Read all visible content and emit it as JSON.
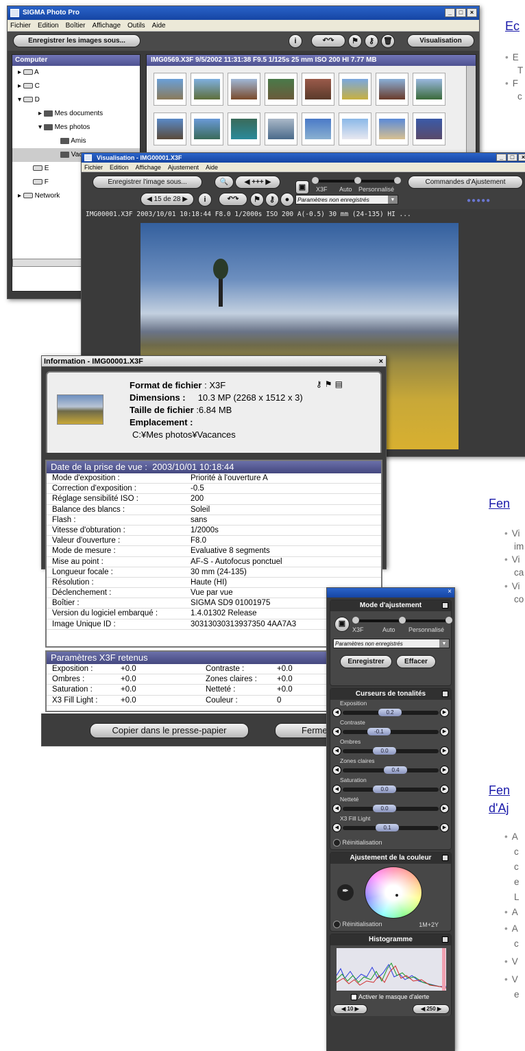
{
  "main_window": {
    "title": "SIGMA Photo Pro",
    "menu": [
      "Fichier",
      "Edition",
      "Boîtier",
      "Affichage",
      "Outils",
      "Aide"
    ],
    "save_images_label": "Enregistrer les images sous...",
    "view_label": "Visualisation",
    "panel_header": "Computer",
    "info_bar": "IMG0569.X3F 9/5/2002 11:31:38 F9.5 1/125s 25 mm ISO 200 HI 7.77 MB",
    "tree": [
      "A",
      "C",
      "D",
      "Mes documents",
      "Mes photos",
      "Amis",
      "Vacances",
      "E",
      "F",
      "Network"
    ]
  },
  "view_window": {
    "title": "Visualisation - IMG00001.X3F",
    "menu": [
      "Fichier",
      "Edition",
      "Affichage",
      "Ajustement",
      "Aide"
    ],
    "save_image_label": "Enregistrer l'image sous...",
    "zoom_label": "+++",
    "mode_x3f": "X3F",
    "mode_auto": "Auto",
    "mode_custom": "Personnalisé",
    "adjust_cmd_label": "Commandes d'Ajustement",
    "counter": "15 de 28",
    "params_unsaved": "Paramètres non enregistrés",
    "status": "IMG00001.X3F   2003/10/01   10:18:44   F8.0   1/2000s   ISO 200   A(-0.5)   30 mm (24-135)   HI   ..."
  },
  "info_window": {
    "title": "Information - IMG00001.X3F",
    "format_label": "Format de fichier",
    "format_value": "X3F",
    "dimensions_label": "Dimensions :",
    "dimensions_value": "10.3 MP (2268 x 1512 x 3)",
    "size_label": "Taille de fichier",
    "size_value": ":6.84 MB",
    "location_label": "Emplacement :",
    "location_value": "C:¥Mes photos¥Vacances",
    "date_label": "Date de la prise de vue :",
    "date_value": "2003/10/01    10:18:44",
    "rows": [
      {
        "k": "Mode d'exposition :",
        "v": "Priorité à l'ouverture A"
      },
      {
        "k": "Correction d'exposition :",
        "v": "-0.5"
      },
      {
        "k": "Réglage sensibilité ISO :",
        "v": "200"
      },
      {
        "k": "Balance des blancs :",
        "v": "Soleil"
      },
      {
        "k": "Flash :",
        "v": "sans"
      },
      {
        "k": "Vitesse d'obturation :",
        "v": "1/2000s"
      },
      {
        "k": "Valeur d'ouverture :",
        "v": "F8.0"
      },
      {
        "k": "Mode de mesure :",
        "v": "Evaluative 8 segments"
      },
      {
        "k": "Mise au point :",
        "v": "AF-S - Autofocus ponctuel"
      },
      {
        "k": "Longueur focale :",
        "v": "30 mm (24-135)"
      },
      {
        "k": "Résolution :",
        "v": "Haute (HI)"
      },
      {
        "k": "Déclenchement :",
        "v": "Vue par vue"
      },
      {
        "k": "Boîtier :",
        "v": "SIGMA SD9 01001975"
      },
      {
        "k": "Version du logiciel embarqué :",
        "v": "1.4.01302 Release"
      },
      {
        "k": "Image Unique ID :",
        "v": "30313030313937350 4AA7A3"
      }
    ],
    "x3f_header": "Paramètres X3F retenus",
    "x3f_rows": [
      {
        "a": "Exposition :",
        "av": "+0.0",
        "b": "Contraste :",
        "bv": "+0.0"
      },
      {
        "a": "Ombres :",
        "av": "+0.0",
        "b": "Zones claires :",
        "bv": "+0.0"
      },
      {
        "a": "Saturation :",
        "av": "+0.0",
        "b": "Netteté :",
        "bv": "+0.0"
      },
      {
        "a": "X3 Fill Light :",
        "av": "+0.0",
        "b": "Couleur :",
        "bv": "0"
      }
    ],
    "copy_label": "Copier dans le presse-papier",
    "close_label": "Fermer"
  },
  "palette": {
    "mode_header": "Mode d'ajustement",
    "mode_x3f": "X3F",
    "mode_auto": "Auto",
    "mode_custom": "Personnalisé",
    "params": "Paramètres non enregistrés",
    "save_label": "Enregistrer",
    "clear_label": "Effacer",
    "tone_header": "Curseurs de tonalités",
    "sliders": [
      {
        "label": "Exposition",
        "value": "0.2"
      },
      {
        "label": "Contraste",
        "value": "-0.1"
      },
      {
        "label": "Ombres",
        "value": "0.0"
      },
      {
        "label": "Zones claires",
        "value": "0.4"
      },
      {
        "label": "Saturation",
        "value": "0.0"
      },
      {
        "label": "Netteté",
        "value": "0.0"
      },
      {
        "label": "X3 Fill Light",
        "value": "0.1"
      }
    ],
    "reset_label": "Réinitialisation",
    "color_header": "Ajustement de la couleur",
    "color_reset_label": "Réinitialisation",
    "color_value": "1M+2Y",
    "histo_header": "Histogramme",
    "alert_label": "Activer le masque d'alerte",
    "low_value": "10",
    "high_value": "250"
  },
  "page_text": {
    "link1": "Ec",
    "bullets1": [
      "E",
      "T",
      "F",
      "c"
    ],
    "link2": "Fen",
    "bullets2": [
      "Vi",
      "im",
      "Vi",
      "ca",
      "Vi",
      "co"
    ],
    "link3a": "Fen",
    "link3b": "d'Aj",
    "bullets3": [
      "A",
      "c",
      "c",
      "e",
      "L",
      "A",
      "A",
      "c",
      "V",
      "V",
      "e"
    ]
  }
}
